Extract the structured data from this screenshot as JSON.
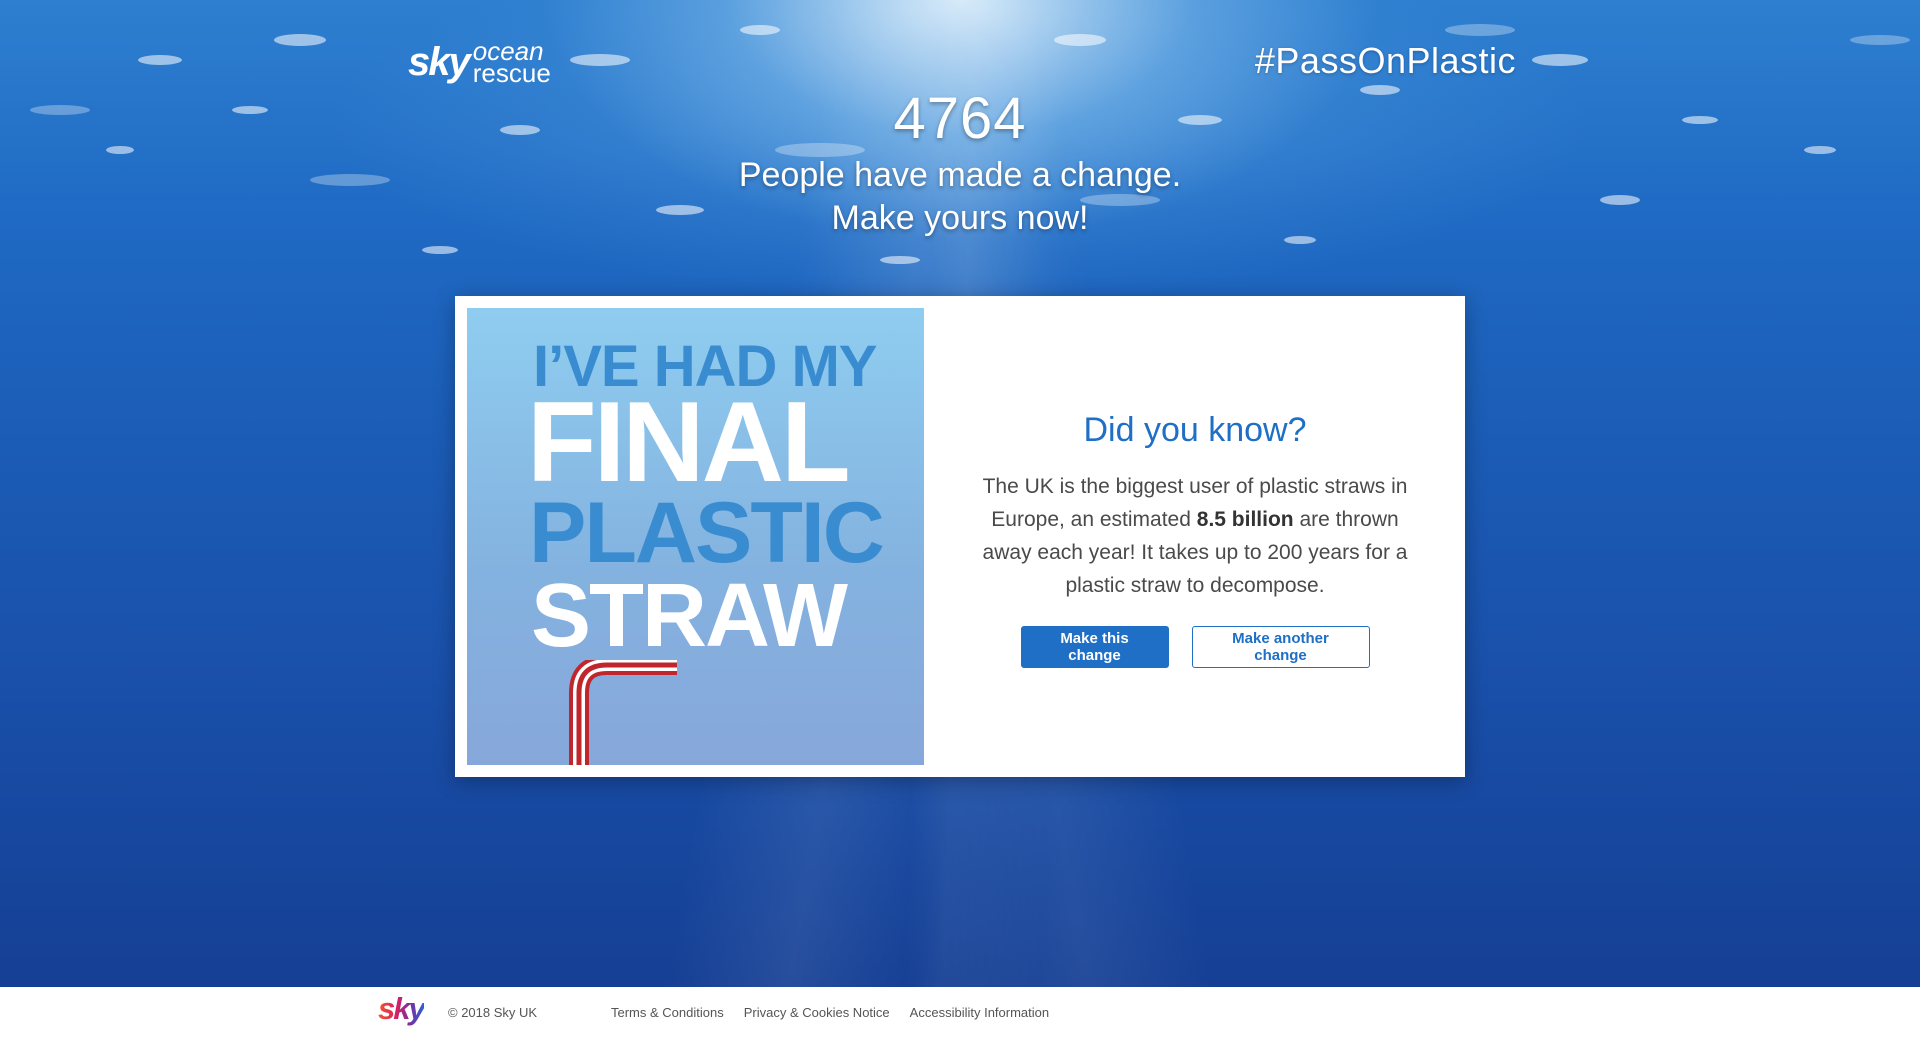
{
  "header": {
    "logo_brand": "sky",
    "logo_word1": "ocean",
    "logo_word2": "rescue",
    "hashtag": "#PassOnPlastic"
  },
  "hero": {
    "count": "4764",
    "line1": "People have made a change.",
    "line2": "Make yours now!"
  },
  "card": {
    "poster": {
      "line1": "I’VE HAD MY",
      "line2": "FINAL",
      "line3": "PLASTIC",
      "line4": "STRAW",
      "icon": "straw-icon"
    },
    "heading": "Did you know?",
    "body_before": "The UK is the biggest user of plastic straws in Europe, an estimated ",
    "body_bold": "8.5 billion",
    "body_after": " are thrown away each year! It takes up to 200 years for a plastic straw to decompose.",
    "primary_button": "Make this change",
    "secondary_button": "Make another change"
  },
  "footer": {
    "brand": "sky",
    "copyright": "© 2018 Sky UK",
    "links": [
      "Terms & Conditions",
      "Privacy & Cookies Notice",
      "Accessibility Information"
    ]
  },
  "colors": {
    "accent": "#1e6fc5",
    "poster_blue": "#3a8cd0",
    "straw_red": "#c0272d"
  }
}
